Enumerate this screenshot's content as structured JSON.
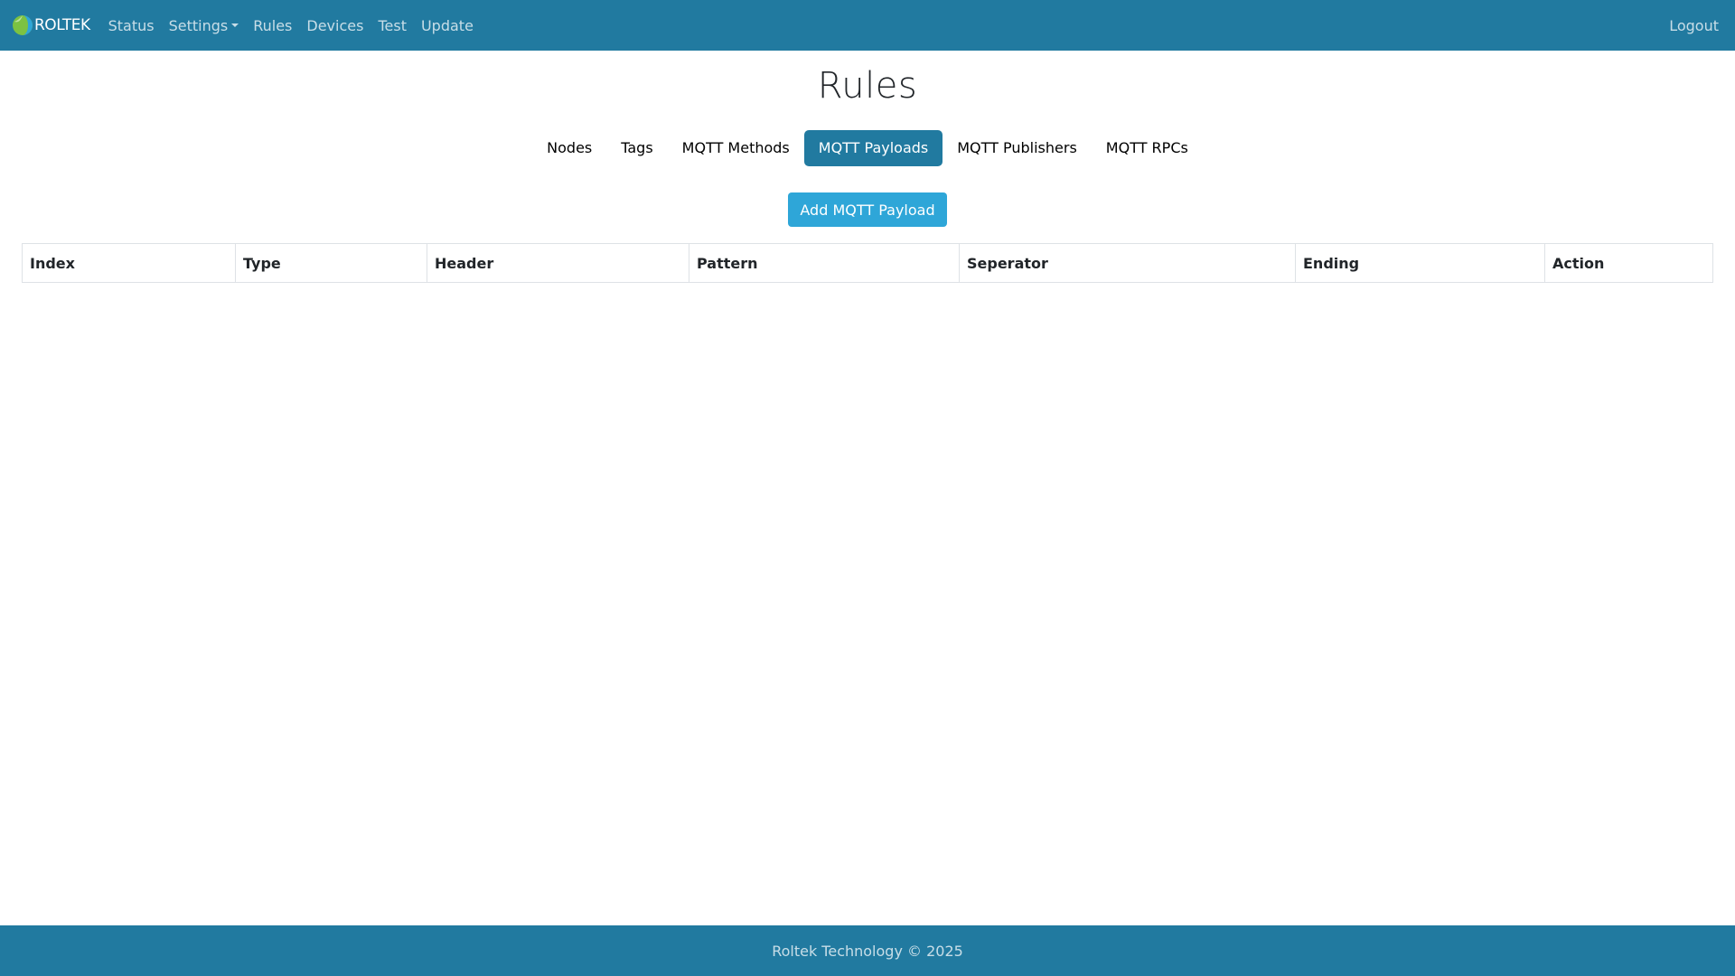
{
  "nav": {
    "brand": "ROLTEK",
    "links": [
      "Status",
      "Settings",
      "Rules",
      "Devices",
      "Test",
      "Update"
    ],
    "logout": "Logout"
  },
  "page": {
    "title": "Rules"
  },
  "tabs": {
    "items": [
      "Nodes",
      "Tags",
      "MQTT Methods",
      "MQTT Payloads",
      "MQTT Publishers",
      "MQTT RPCs"
    ],
    "active": "MQTT Payloads"
  },
  "actions": {
    "add_label": "Add MQTT Payload"
  },
  "table": {
    "columns": [
      "Index",
      "Type",
      "Header",
      "Pattern",
      "Seperator",
      "Ending",
      "Action"
    ],
    "rows": []
  },
  "footer": {
    "text": "Roltek Technology © 2025"
  },
  "colors": {
    "primary": "#217aa0",
    "button": "#2ea6d8",
    "logo_green": "#7cc242",
    "logo_blue": "#2ea6d8"
  }
}
